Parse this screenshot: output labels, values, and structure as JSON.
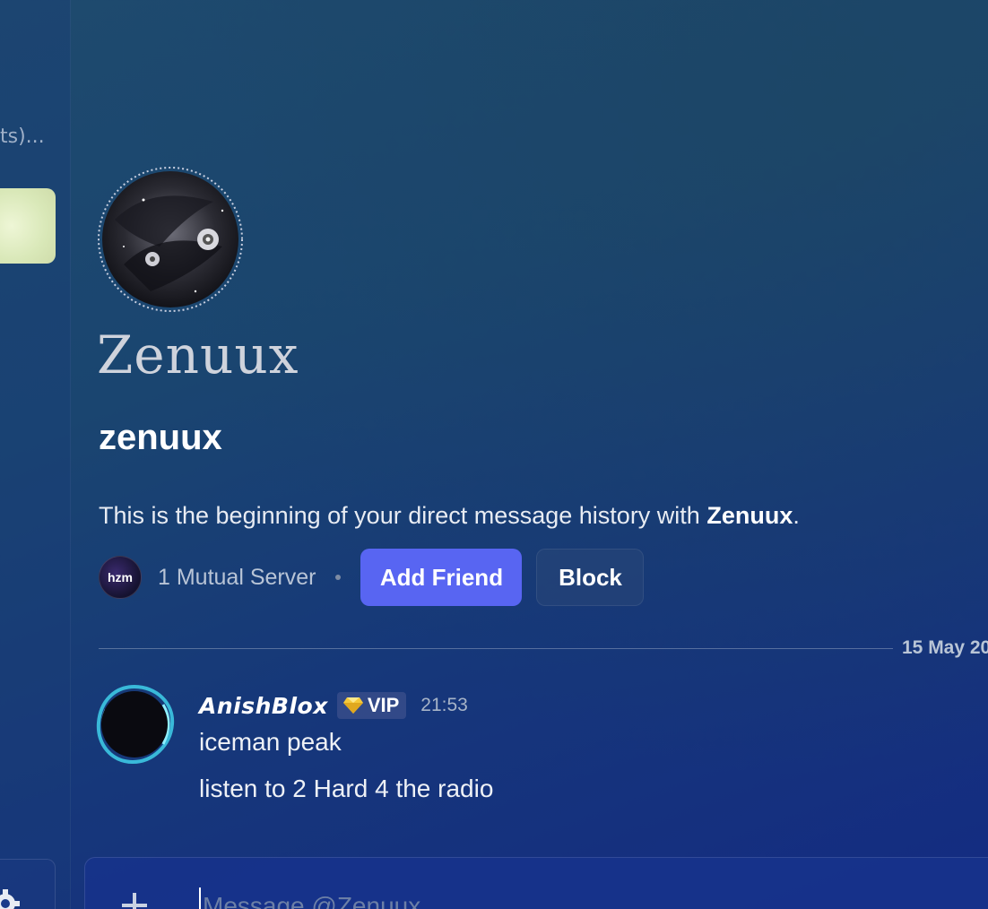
{
  "left_panel": {
    "truncated_text": "ts)..."
  },
  "profile": {
    "display_name": "Zenuux",
    "username": "zenuux",
    "intro_prefix": "This is the beginning of your direct message history with ",
    "intro_name": "Zenuux",
    "intro_suffix": "."
  },
  "mutual": {
    "server_icon_text": "hzm",
    "label": "1 Mutual Server"
  },
  "buttons": {
    "add_friend": "Add Friend",
    "block": "Block"
  },
  "divider": {
    "date": "15 May 20"
  },
  "message": {
    "author": "AnishBlox",
    "badge": "VIP",
    "time": "21:53",
    "lines": [
      "iceman peak",
      "listen to 2 Hard 4 the radio"
    ]
  },
  "composer": {
    "placeholder": "Message @Zenuux"
  },
  "icons": {
    "settings": "gear-icon",
    "attach": "plus-icon",
    "badge": "gem-icon"
  },
  "colors": {
    "accent": "#5865f2",
    "background_top": "#1e4a6e",
    "background_bottom": "#142b82"
  }
}
